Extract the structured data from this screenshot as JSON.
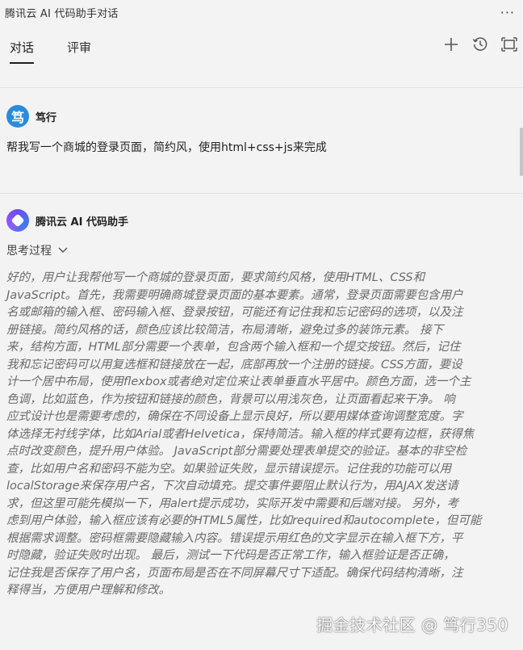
{
  "window": {
    "title": "腾讯云 AI 代码助手对话",
    "more_label": "···"
  },
  "tabs": [
    {
      "label": "对话",
      "active": true
    },
    {
      "label": "评审",
      "active": false
    }
  ],
  "toolbar": {
    "icons": [
      "plus-icon",
      "history-icon",
      "expand-icon"
    ]
  },
  "user_message": {
    "avatar_char": "笃",
    "author": "笃行",
    "text": "帮我写一个商城的登录页面，简约风，使用html+css+js来完成"
  },
  "assistant": {
    "author": "腾讯云 AI 代码助手",
    "thinking_label": "思考过程",
    "reasoning_lines": [
      "好的，用户让我帮他写一个商城的登录页面，要求简约风格，使用HTML、CSS和",
      "JavaScript。首先，我需要明确商城登录页面的基本要素。通常，登录页面需要包含用户",
      "名或邮箱的输入框、密码输入框、登录按钮，可能还有记住我和忘记密码的选项，以及注",
      "册链接。简约风格的话，颜色应该比较简洁，布局清晰，避免过多的装饰元素。 接下",
      "来，结构方面，HTML部分需要一个表单，包含两个输入框和一个提交按钮。然后，记住",
      "我和忘记密码可以用复选框和链接放在一起，底部再放一个注册的链接。CSS方面，要设",
      "计一个居中布局，使用flexbox或者绝对定位来让表单垂直水平居中。颜色方面，选一个主",
      "色调，比如蓝色，作为按钮和链接的颜色，背景可以用浅灰色，让页面看起来干净。 响",
      "应式设计也是需要考虑的，确保在不同设备上显示良好，所以要用媒体查询调整宽度。字",
      "体选择无衬线字体，比如Arial或者Helvetica，保持简洁。输入框的样式要有边框，获得焦",
      "点时改变颜色，提升用户体验。 JavaScript部分需要处理表单提交的验证。基本的非空检",
      "查，比如用户名和密码不能为空。如果验证失败，显示错误提示。记住我的功能可以用",
      "localStorage来保存用户名，下次自动填充。提交事件要阻止默认行为，用AJAX发送请",
      "求，但这里可能先模拟一下，用alert提示成功，实际开发中需要和后端对接。 另外，考",
      "虑到用户体验，输入框应该有必要的HTML5属性，比如required和autocomplete，但可能",
      "根据需求调整。密码框需要隐藏输入内容。错误提示用红色的文字显示在输入框下方，平",
      "时隐藏，验证失败时出现。 最后，测试一下代码是否正常工作，输入框验证是否正确，",
      "记住我是否保存了用户名，页面布局是否在不同屏幕尺寸下适配。确保代码结构清晰，注",
      "释得当，方便用户理解和修改。"
    ]
  },
  "watermark": "掘金技术社区 @ 笃行350"
}
